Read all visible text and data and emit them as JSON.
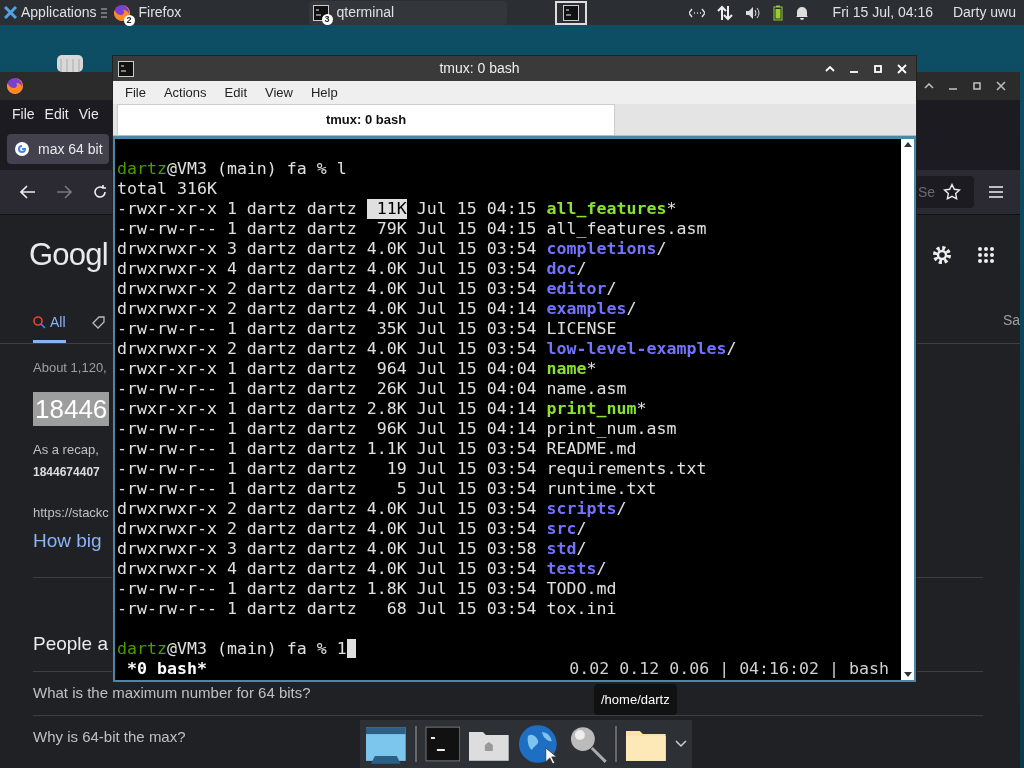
{
  "panel": {
    "menu_label": "Applications",
    "tasks": [
      {
        "label": "Firefox",
        "badge": "2",
        "kind": "browser"
      },
      {
        "label": "qterminal",
        "badge": "3",
        "kind": "terminal"
      }
    ],
    "clock": "Fri 15 Jul, 04:16",
    "user": "Darty uwu"
  },
  "firefox": {
    "menu": [
      "File",
      "Edit",
      "Vie"
    ],
    "tab": "max 64 bit",
    "address_tail": "Se",
    "logo": "Googl",
    "all_tab": "All",
    "right_tab": "Sa",
    "result_count": "About 1,120,",
    "answer": "18446",
    "snippet": "As a recap, ",
    "snippet_bold": "1844674407",
    "url": "https://stackc",
    "link": "How big",
    "people_heading": "People a",
    "questions": [
      "What is the maximum number for 64 bits?",
      "Why is 64-bit the max?"
    ]
  },
  "terminal": {
    "title": "tmux: 0 bash",
    "menu": [
      "File",
      "Actions",
      "Edit",
      "View",
      "Help"
    ],
    "tabs": [
      {
        "label": "tmux: 0 bash",
        "selected": true
      }
    ],
    "prompt": {
      "user": "dartz",
      "rest": "@VM3 (main) fa % ",
      "command": "l"
    },
    "total": "total 316K",
    "entries": [
      {
        "mode": "-rwxr-xr-x",
        "links": "1",
        "owner": "dartz",
        "group": "dartz",
        "size": "11K",
        "date": "Jul 15 04:15",
        "name": "all_features",
        "suffix": "*",
        "kind": "exec",
        "size_highlighted": true
      },
      {
        "mode": "-rw-rw-r--",
        "links": "1",
        "owner": "dartz",
        "group": "dartz",
        "size": "79K",
        "date": "Jul 15 04:15",
        "name": "all_features.asm",
        "kind": "file",
        "size_highlighted": false
      },
      {
        "mode": "drwxrwxr-x",
        "links": "3",
        "owner": "dartz",
        "group": "dartz",
        "size": "4.0K",
        "date": "Jul 15 03:54",
        "name": "completions",
        "suffix": "/",
        "kind": "dir",
        "size_highlighted": false
      },
      {
        "mode": "drwxrwxr-x",
        "links": "4",
        "owner": "dartz",
        "group": "dartz",
        "size": "4.0K",
        "date": "Jul 15 03:54",
        "name": "doc",
        "suffix": "/",
        "kind": "dir",
        "size_highlighted": false
      },
      {
        "mode": "drwxrwxr-x",
        "links": "2",
        "owner": "dartz",
        "group": "dartz",
        "size": "4.0K",
        "date": "Jul 15 03:54",
        "name": "editor",
        "suffix": "/",
        "kind": "dir",
        "size_highlighted": false
      },
      {
        "mode": "drwxrwxr-x",
        "links": "2",
        "owner": "dartz",
        "group": "dartz",
        "size": "4.0K",
        "date": "Jul 15 04:14",
        "name": "examples",
        "suffix": "/",
        "kind": "dir",
        "size_highlighted": false
      },
      {
        "mode": "-rw-rw-r--",
        "links": "1",
        "owner": "dartz",
        "group": "dartz",
        "size": "35K",
        "date": "Jul 15 03:54",
        "name": "LICENSE",
        "kind": "file",
        "size_highlighted": false
      },
      {
        "mode": "drwxrwxr-x",
        "links": "2",
        "owner": "dartz",
        "group": "dartz",
        "size": "4.0K",
        "date": "Jul 15 03:54",
        "name": "low-level-examples",
        "suffix": "/",
        "kind": "dir",
        "size_highlighted": false
      },
      {
        "mode": "-rwxr-xr-x",
        "links": "1",
        "owner": "dartz",
        "group": "dartz",
        "size": "964",
        "date": "Jul 15 04:04",
        "name": "name",
        "suffix": "*",
        "kind": "exec",
        "size_highlighted": false
      },
      {
        "mode": "-rw-rw-r--",
        "links": "1",
        "owner": "dartz",
        "group": "dartz",
        "size": "26K",
        "date": "Jul 15 04:04",
        "name": "name.asm",
        "kind": "file",
        "size_highlighted": false
      },
      {
        "mode": "-rwxr-xr-x",
        "links": "1",
        "owner": "dartz",
        "group": "dartz",
        "size": "2.8K",
        "date": "Jul 15 04:14",
        "name": "print_num",
        "suffix": "*",
        "kind": "exec",
        "size_highlighted": false
      },
      {
        "mode": "-rw-rw-r--",
        "links": "1",
        "owner": "dartz",
        "group": "dartz",
        "size": "96K",
        "date": "Jul 15 04:14",
        "name": "print_num.asm",
        "kind": "file",
        "size_highlighted": false
      },
      {
        "mode": "-rw-rw-r--",
        "links": "1",
        "owner": "dartz",
        "group": "dartz",
        "size": "1.1K",
        "date": "Jul 15 03:54",
        "name": "README.md",
        "kind": "file",
        "size_highlighted": false
      },
      {
        "mode": "-rw-rw-r--",
        "links": "1",
        "owner": "dartz",
        "group": "dartz",
        "size": "19",
        "date": "Jul 15 03:54",
        "name": "requirements.txt",
        "kind": "file",
        "size_highlighted": false
      },
      {
        "mode": "-rw-rw-r--",
        "links": "1",
        "owner": "dartz",
        "group": "dartz",
        "size": "5",
        "date": "Jul 15 03:54",
        "name": "runtime.txt",
        "kind": "file",
        "size_highlighted": false
      },
      {
        "mode": "drwxrwxr-x",
        "links": "2",
        "owner": "dartz",
        "group": "dartz",
        "size": "4.0K",
        "date": "Jul 15 03:54",
        "name": "scripts",
        "suffix": "/",
        "kind": "dir",
        "size_highlighted": false
      },
      {
        "mode": "drwxrwxr-x",
        "links": "2",
        "owner": "dartz",
        "group": "dartz",
        "size": "4.0K",
        "date": "Jul 15 03:54",
        "name": "src",
        "suffix": "/",
        "kind": "dir",
        "size_highlighted": false
      },
      {
        "mode": "drwxrwxr-x",
        "links": "3",
        "owner": "dartz",
        "group": "dartz",
        "size": "4.0K",
        "date": "Jul 15 03:58",
        "name": "std",
        "suffix": "/",
        "kind": "dir",
        "size_highlighted": false
      },
      {
        "mode": "drwxrwxr-x",
        "links": "4",
        "owner": "dartz",
        "group": "dartz",
        "size": "4.0K",
        "date": "Jul 15 03:54",
        "name": "tests",
        "suffix": "/",
        "kind": "dir",
        "size_highlighted": false
      },
      {
        "mode": "-rw-rw-r--",
        "links": "1",
        "owner": "dartz",
        "group": "dartz",
        "size": "1.8K",
        "date": "Jul 15 03:54",
        "name": "TODO.md",
        "kind": "file",
        "size_highlighted": false
      },
      {
        "mode": "-rw-rw-r--",
        "links": "1",
        "owner": "dartz",
        "group": "dartz",
        "size": "68",
        "date": "Jul 15 03:54",
        "name": "tox.ini",
        "kind": "file",
        "size_highlighted": false
      }
    ],
    "prompt2": {
      "user": "dartz",
      "rest": "@VM3 (main) fa % ",
      "command": "1"
    },
    "status": {
      "left": "*0 bash*",
      "right": "0.02 0.12 0.06 | 04:16:02 | bash"
    }
  },
  "tooltip": "/home/dartz"
}
